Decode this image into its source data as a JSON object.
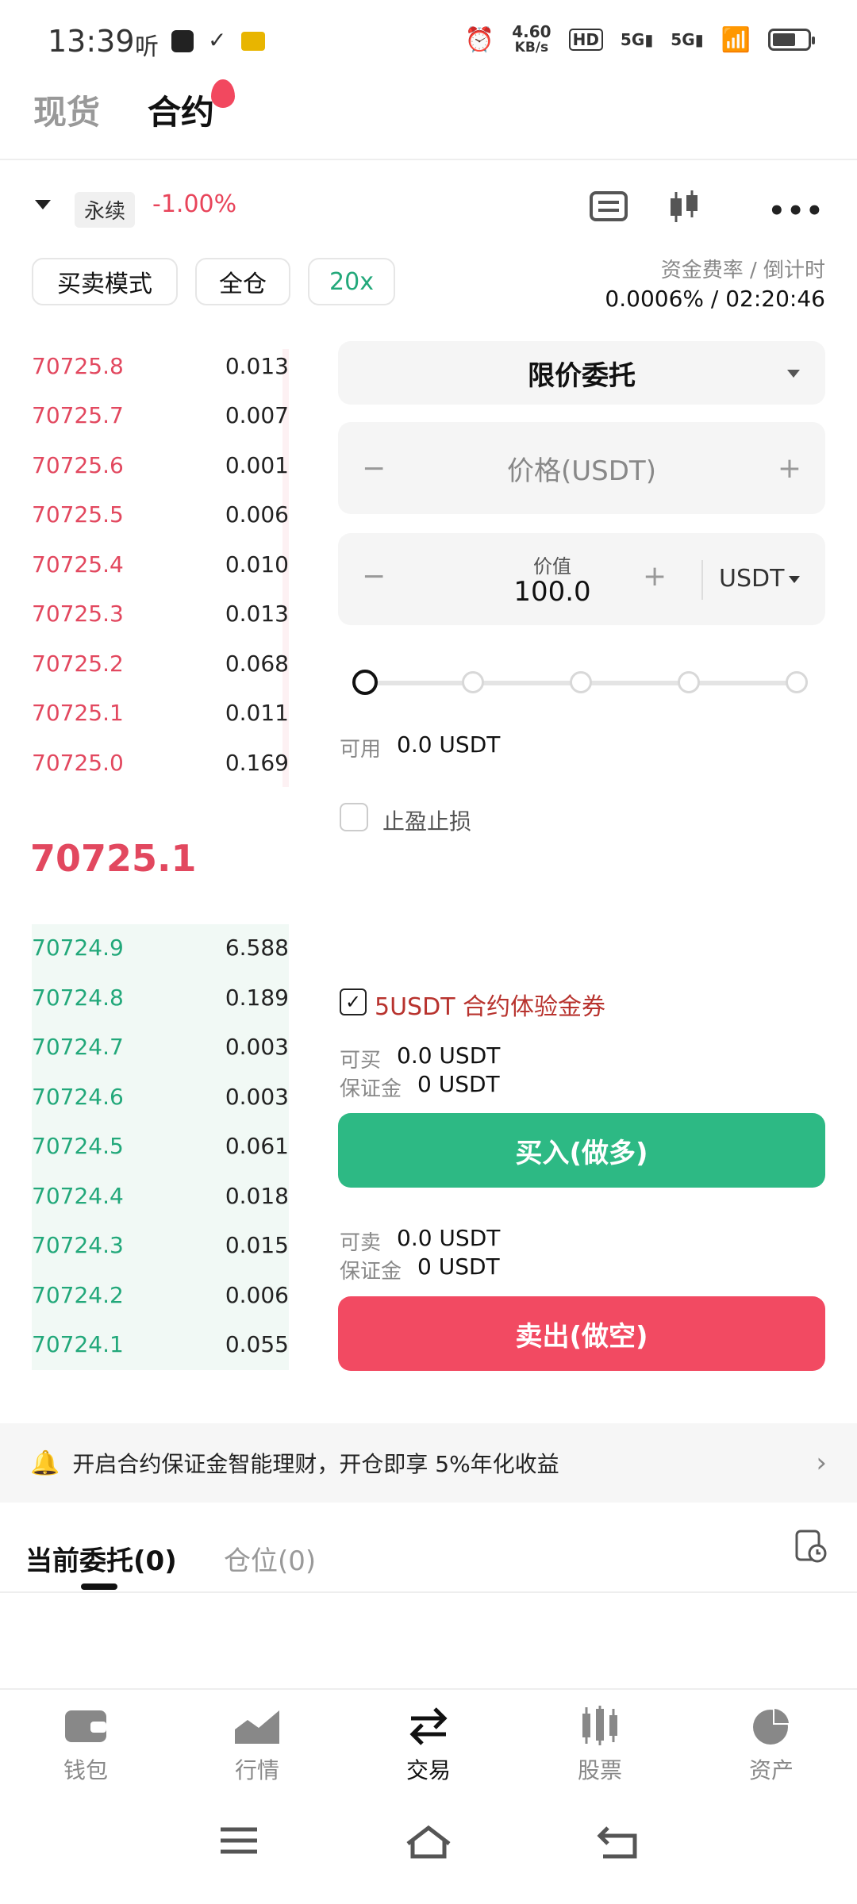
{
  "status_bar": {
    "time": "13:39",
    "app_glyph": "听",
    "net_speed_top": "4.60",
    "net_speed_unit": "KB/s",
    "signal1": "5G",
    "signal2": "5G",
    "hd": "HD"
  },
  "top_tabs": {
    "spot": "现货",
    "contract": "合约"
  },
  "market": {
    "perp_tag": "永续",
    "change": "-1.00%"
  },
  "modes": {
    "trade_mode": "买卖模式",
    "margin_mode": "全仓",
    "leverage": "20x"
  },
  "funding": {
    "label": "资金费率 / 倒计时",
    "value": "0.0006% / 02:20:46"
  },
  "orderbook": {
    "asks": [
      {
        "price": "70725.8",
        "qty": "0.013"
      },
      {
        "price": "70725.7",
        "qty": "0.007"
      },
      {
        "price": "70725.6",
        "qty": "0.001"
      },
      {
        "price": "70725.5",
        "qty": "0.006"
      },
      {
        "price": "70725.4",
        "qty": "0.010"
      },
      {
        "price": "70725.3",
        "qty": "0.013"
      },
      {
        "price": "70725.2",
        "qty": "0.068"
      },
      {
        "price": "70725.1",
        "qty": "0.011"
      },
      {
        "price": "70725.0",
        "qty": "0.169"
      }
    ],
    "last_price": "70725.1",
    "bids": [
      {
        "price": "70724.9",
        "qty": "6.588"
      },
      {
        "price": "70724.8",
        "qty": "0.189"
      },
      {
        "price": "70724.7",
        "qty": "0.003"
      },
      {
        "price": "70724.6",
        "qty": "0.003"
      },
      {
        "price": "70724.5",
        "qty": "0.061"
      },
      {
        "price": "70724.4",
        "qty": "0.018"
      },
      {
        "price": "70724.3",
        "qty": "0.015"
      },
      {
        "price": "70724.2",
        "qty": "0.006"
      },
      {
        "price": "70724.1",
        "qty": "0.055"
      }
    ]
  },
  "form": {
    "order_type": "限价委托",
    "price_placeholder": "价格(USDT)",
    "value_label": "价值",
    "value": "100.0",
    "unit": "USDT",
    "minus": "−",
    "plus": "+",
    "available_label": "可用",
    "available_value": "0.0 USDT",
    "tpsl_label": "止盈止损",
    "coupon_label": "5USDT 合约体验金券",
    "buy_can_label": "可买",
    "buy_can_value": "0.0 USDT",
    "buy_margin_label": "保证金",
    "buy_margin_value": "0 USDT",
    "buy_button": "买入(做多)",
    "sell_can_label": "可卖",
    "sell_can_value": "0.0 USDT",
    "sell_margin_label": "保证金",
    "sell_margin_value": "0 USDT",
    "sell_button": "卖出(做空)"
  },
  "banner": {
    "text": "开启合约保证金智能理财，开仓即享 5%年化收益"
  },
  "bottom_tabs": {
    "orders": "当前委托(0)",
    "positions": "仓位(0)"
  },
  "nav": [
    {
      "label": "钱包",
      "icon": "wallet-icon"
    },
    {
      "label": "行情",
      "icon": "chart-icon"
    },
    {
      "label": "交易",
      "icon": "trade-icon"
    },
    {
      "label": "股票",
      "icon": "stocks-icon"
    },
    {
      "label": "资产",
      "icon": "pie-icon"
    }
  ],
  "colors": {
    "buy": "#2db984",
    "sell": "#f24a62",
    "accent_green": "#22a87a"
  }
}
